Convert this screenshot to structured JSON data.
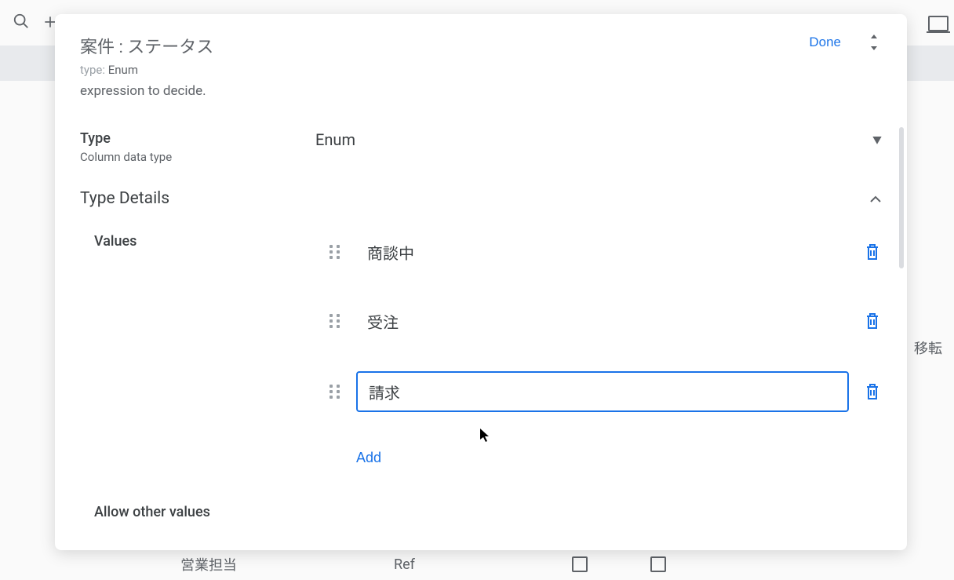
{
  "header": {
    "title": "案件 : ステータス",
    "type_label": "type:",
    "type_value": "Enum",
    "done_label": "Done"
  },
  "body": {
    "expression_text": "expression to decide.",
    "type_section": {
      "label": "Type",
      "sublabel": "Column data type",
      "value": "Enum"
    },
    "type_details": {
      "title": "Type Details",
      "values_label": "Values",
      "values": [
        {
          "text": "商談中",
          "active": false
        },
        {
          "text": "受注",
          "active": false
        },
        {
          "text": "請求",
          "active": true
        }
      ],
      "add_label": "Add",
      "allow_other_label": "Allow other values"
    }
  },
  "backdrop": {
    "side_text": "移転",
    "bottom_left": "営業担当",
    "bottom_mid": "Ref"
  }
}
